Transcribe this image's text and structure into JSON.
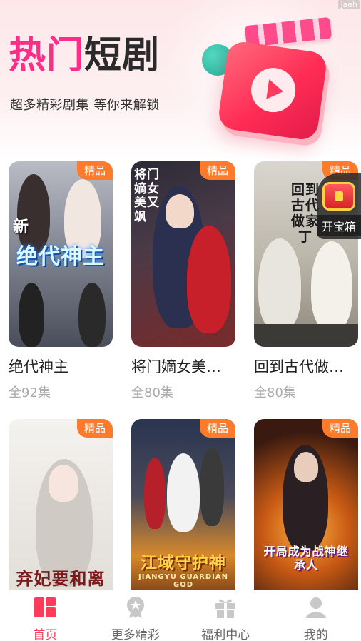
{
  "watermark": "jaeh",
  "header": {
    "title_part1": "热门",
    "title_part2": "短剧",
    "subtitle": "超多精彩剧集 等你来解锁"
  },
  "badge_label": "精品",
  "cards": [
    {
      "name": "绝代神主",
      "episodes": "全92集",
      "poster_text": "绝代神主",
      "poster_side": "新"
    },
    {
      "name": "将门嫡女美…",
      "episodes": "全80集",
      "poster_text": "将门嫡女美又飒"
    },
    {
      "name": "回到古代做…",
      "episodes": "全80集",
      "poster_text": "回到古代做家丁"
    },
    {
      "name": "",
      "episodes": "",
      "poster_text": "弃妃要和离"
    },
    {
      "name": "",
      "episodes": "",
      "poster_text": "江域守护神",
      "poster_sub": "JIANGYU GUARDIAN GOD"
    },
    {
      "name": "",
      "episodes": "",
      "poster_text": "开局成为战神继承人"
    }
  ],
  "treasure": {
    "label": "开宝箱"
  },
  "bottom_nav": {
    "items": [
      {
        "label": "首页",
        "icon": "home-grid-icon",
        "active": true
      },
      {
        "label": "更多精彩",
        "icon": "star-badge-icon",
        "active": false
      },
      {
        "label": "福利中心",
        "icon": "gift-icon",
        "active": false
      },
      {
        "label": "我的",
        "icon": "user-icon",
        "active": false
      }
    ]
  },
  "colors": {
    "accent": "#ff3b5c",
    "title_pink": "#ff2d8a",
    "badge": "#ff7a2a"
  }
}
